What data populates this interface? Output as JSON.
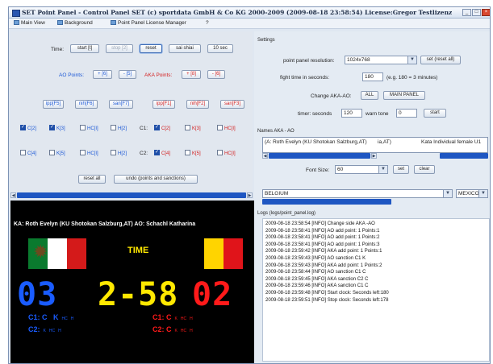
{
  "window": {
    "title": "SET Point Panel - Control Panel SET (c) sportdata GmbH & Co KG 2000-2009 (2009-08-18 23:58:54)  License:Gregor Testlizenz"
  },
  "menu": [
    {
      "label": "Main View"
    },
    {
      "label": "Background"
    },
    {
      "label": "Point Panel License Manager"
    },
    {
      "label": "?"
    }
  ],
  "controls": {
    "time_label": "Time:",
    "start": "start [t]",
    "stop": "stop [2]",
    "reset": "reset",
    "sai_shiai": "sai shiai",
    "ten_sec": "10 sec",
    "ao_points": "AO Points:",
    "ao_plus": "+ [6]",
    "ao_minus": "- [5]",
    "aka_points": "AKA Points:",
    "aka_plus": "+ [8]",
    "aka_minus": "- [6]",
    "ipp_ao": "ipp[F5]",
    "nih_ao": "nih[F6]",
    "san_ao": "san[F7]",
    "ipp_aka": "ipp[F1]",
    "nih_aka": "nih[F2]",
    "san_aka": "san[F3]",
    "c1": "C1:",
    "c2": "C2:",
    "row1_ao": [
      {
        "label": "C[2]",
        "checked": true
      },
      {
        "label": "K[3]",
        "checked": true
      },
      {
        "label": "HC[I]",
        "checked": false
      },
      {
        "label": "H[2]",
        "checked": false
      }
    ],
    "row1_aka": [
      {
        "label": "C[2]",
        "checked": true
      },
      {
        "label": "K[3]",
        "checked": false
      },
      {
        "label": "HC[I]",
        "checked": false
      }
    ],
    "row2_ao": [
      {
        "label": "C[4]",
        "checked": false
      },
      {
        "label": "K[5]",
        "checked": false
      },
      {
        "label": "HC[I]",
        "checked": false
      },
      {
        "label": "H[2]",
        "checked": false
      }
    ],
    "row2_aka": [
      {
        "label": "C[4]",
        "checked": true
      },
      {
        "label": "K[5]",
        "checked": false
      },
      {
        "label": "HC[I]",
        "checked": false
      }
    ],
    "reset_all": "reset all",
    "undo": "undo (points and sanctions)"
  },
  "board": {
    "names": "KA: Roth Evelyn (KU Shotokan Salzburg,AT)  AO: Schachl Katharina",
    "time_label": "TIME",
    "score_left": "03",
    "clock": "2-58",
    "score_right": "02",
    "left_c1": "C1: C",
    "left_c1_k": "K",
    "left_c2": "C2:",
    "right_c1": "C1: C",
    "right_c2": "C2: C",
    "hc": "HC",
    "h": "H",
    "k": "K",
    "colors": {
      "blue": "#1a5cff",
      "yellow": "#ffe800",
      "red": "#ff1a1a"
    },
    "flag_left": [
      "#0a7a2e",
      "#ffffff",
      "#d41a1a"
    ],
    "flag_right": [
      "#000000",
      "#ffd400",
      "#e0141a"
    ]
  },
  "settings": {
    "title": "Settings",
    "resolution_label": "point panel resolution:",
    "resolution_value": "1024x768",
    "set_reset_all": "set (reset all)",
    "fight_time_label": "fight time in seconds:",
    "fight_time_value": "180",
    "fight_time_hint": "(e.g. 180 = 3 minutes)",
    "change_label": "Change AKA-AO:",
    "all": "ALL",
    "main_panel": "MAIN PANEL",
    "timer_label": "timer: seconds",
    "timer_value": "120",
    "warn_label": "warn tone",
    "warn_value": "0",
    "start": "start"
  },
  "names": {
    "title": "Names AKA - AO",
    "aka": "(A:  Roth Evelyn (KU Shotokan Salzburg,AT)",
    "ao": "ia,AT)",
    "category": "Kata Individual female U1",
    "font_size_label": "Font Size:",
    "font_size_value": "60",
    "set": "set",
    "clear": "clear",
    "country_left": "BELGIUM",
    "country_right": "MEXICO"
  },
  "log": {
    "title": "Logs (logs/point_panel.log)",
    "lines": [
      "2009-08-18 23:58:54 [INFO] Change side AKA -AO",
      "2009-08-18 23:58:41 [INFO] AO add point: 1 Points:1",
      "2009-08-18 23:58:41 [INFO] AO add point: 1 Points:2",
      "2009-08-18 23:58:41 [INFO] AO add point: 1 Points:3",
      "2009-08-18 23:59:42 [INFO] AKA add point: 1 Points:1",
      "2009-08-18 23:59:43 [INFO] AO sanction C1 K",
      "2009-08-18 23:59:43 [INFO] AKA add point: 1 Points:2",
      "2009-08-18 23:58:44 [INFO] AO sanction C1 C",
      "2009-08-18 23:59:45 [INFO] AKA sanction C2 C",
      "2009-08-18 23:59:46 [INFO] AKA sanction C1 C",
      "2009-08-18 23:59:48 [INFO] Start clock: Seconds left:180",
      "2009-08-18 23:59:51 [INFO] Stop clock: Seconds left:178"
    ]
  }
}
